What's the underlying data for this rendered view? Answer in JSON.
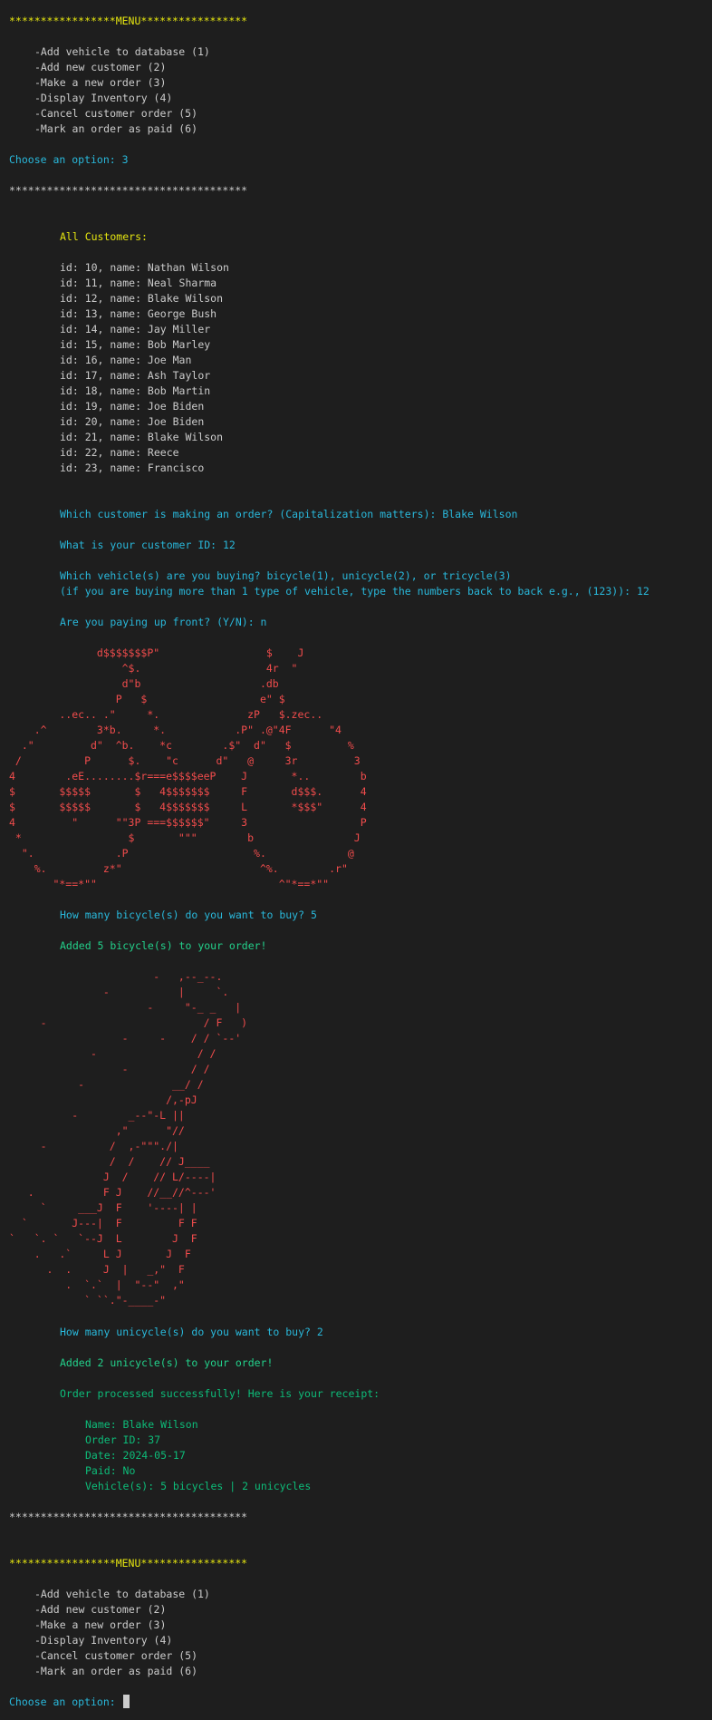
{
  "menu_header": "*****************MENU*****************",
  "menu_items": [
    "-Add vehicle to database (1)",
    "-Add new customer (2)",
    "-Make a new order (3)",
    "-Display Inventory (4)",
    "-Cancel customer order (5)",
    "-Mark an order as paid (6)"
  ],
  "choose_option_answered": "Choose an option: 3",
  "separator": "**************************************",
  "all_customers_label": "All Customers:",
  "customers": [
    "id: 10, name: Nathan Wilson",
    "id: 11, name: Neal Sharma",
    "id: 12, name: Blake Wilson",
    "id: 13, name: George Bush",
    "id: 14, name: Jay Miller",
    "id: 15, name: Bob Marley",
    "id: 16, name: Joe Man",
    "id: 17, name: Ash Taylor",
    "id: 18, name: Bob Martin",
    "id: 19, name: Joe Biden",
    "id: 20, name: Joe Biden",
    "id: 21, name: Blake Wilson",
    "id: 22, name: Reece",
    "id: 23, name: Francisco"
  ],
  "q_customer": "Which customer is making an order? (Capitalization matters): Blake Wilson",
  "q_id": "What is your customer ID: 12",
  "q_vehicles_1": "Which vehicle(s) are you buying? bicycle(1), unicycle(2), or tricycle(3)",
  "q_vehicles_2": "(if you are buying more than 1 type of vehicle, type the numbers back to back e.g., (123)): 12",
  "q_upfront": "Are you paying up front? (Y/N): n",
  "bicycle_art": [
    "              d$$$$$$$P\"                 $    J",
    "                  ^$.                    4r  \"",
    "                  d\"b                   .db",
    "                 P   $                  e\" $",
    "        ..ec.. .\"     *.              zP   $.zec..",
    "    .^        3*b.     *.           .P\" .@\"4F      \"4",
    "  .\"         d\"  ^b.    *c        .$\"  d\"   $         %",
    " /          P      $.    \"c      d\"   @     3r         3",
    "4        .eE........$r===e$$$$eeP    J       *..        b",
    "$       $$$$$       $   4$$$$$$$     F       d$$$.      4",
    "$       $$$$$       $   4$$$$$$$     L       *$$$\"      4",
    "4         \"      \"\"3P ===$$$$$$\"     3                  P",
    " *                 $       \"\"\"        b                J",
    "  \".             .P                    %.             @",
    "    %.         z*\"                      ^%.        .r\"",
    "       \"*==*\"\"                             ^\"*==*\"\""
  ],
  "q_bicycles": "How many bicycle(s) do you want to buy? 5",
  "added_bicycles": "Added 5 bicycle(s) to your order!",
  "unicycle_art": [
    "                       -   ,--_--.",
    "               -           |     `.",
    "                      -     \"-_ _   |",
    "     -                         / F   )",
    "                  -     -    / / `--'",
    "             -                / /",
    "                  -          / /",
    "           -              __/ /",
    "                         /,-pJ",
    "          -        _--\"-L ||",
    "                 ,\"      \"//",
    "     -          /  ,-\"\"\"./|",
    "                /  /    // J____",
    "               J  /    // L/----|",
    "   .           F J    //__//^---'",
    "     `     ___J  F    '----| |",
    "  `       J---|  F         F F",
    "`   `. `   `--J  L        J  F",
    "    .   .`     L J       J  F",
    "      .  .     J  |   _,\"  F",
    "         .  `.`  |  \"--\"  ,\"",
    "            ` ``.\"-____-\""
  ],
  "q_unicycles": "How many unicycle(s) do you want to buy? 2",
  "added_unicycles": "Added 2 unicycle(s) to your order!",
  "receipt_intro": "Order processed successfully! Here is your receipt:",
  "receipt": {
    "name": "Name: Blake Wilson",
    "order_id": "Order ID: 37",
    "date": "Date: 2024-05-17",
    "paid": "Paid: No",
    "vehicles": "Vehicle(s): 5 bicycles | 2 unicycles"
  },
  "choose_option_prompt": "Choose an option: "
}
